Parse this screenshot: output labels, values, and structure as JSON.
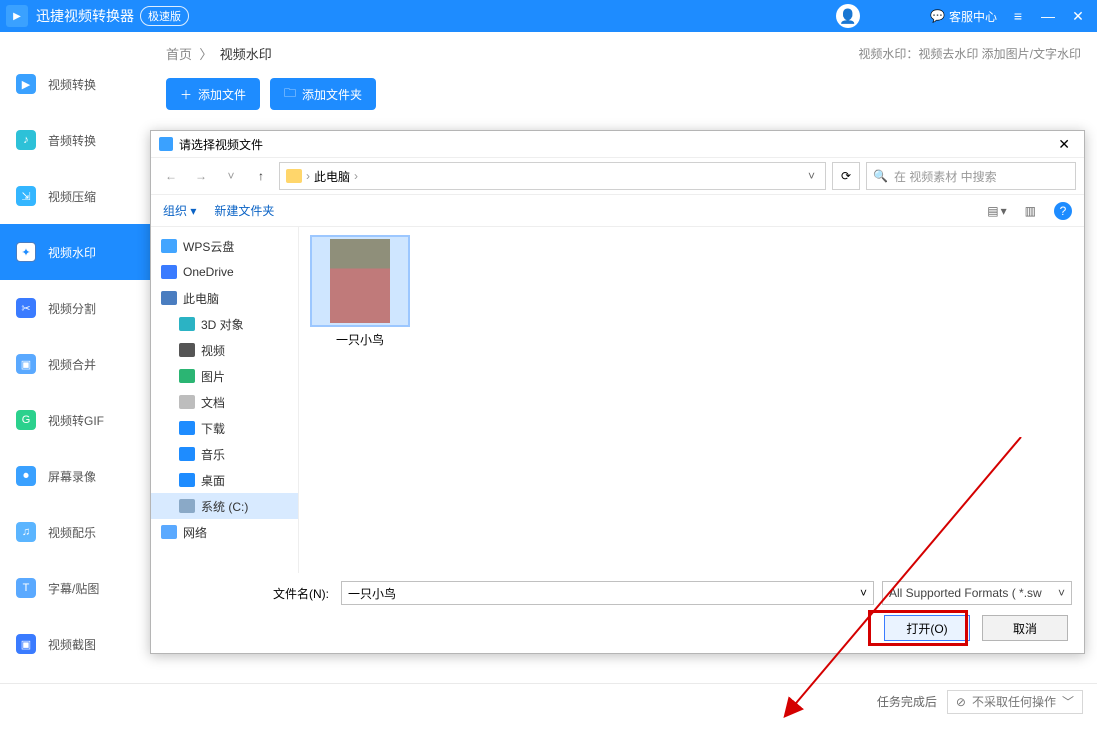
{
  "titlebar": {
    "app_name": "迅捷视频转换器",
    "version_badge": "极速版",
    "help_center": "客服中心"
  },
  "sidebar": {
    "items": [
      {
        "label": "视频转换"
      },
      {
        "label": "音频转换"
      },
      {
        "label": "视频压缩"
      },
      {
        "label": "视频水印"
      },
      {
        "label": "视频分割"
      },
      {
        "label": "视频合并"
      },
      {
        "label": "视频转GIF"
      },
      {
        "label": "屏幕录像"
      },
      {
        "label": "视频配乐"
      },
      {
        "label": "字幕/贴图"
      },
      {
        "label": "视频截图"
      }
    ]
  },
  "crumbs": {
    "home": "首页",
    "sep": "〉",
    "current": "视频水印",
    "hint": "视频水印：视频去水印 添加图片/文字水印"
  },
  "actions": {
    "add_file": "添加文件",
    "add_folder": "添加文件夹"
  },
  "footer": {
    "done_label": "任务完成后",
    "action": "不采取任何操作"
  },
  "dialog": {
    "title": "请选择视频文件",
    "path": {
      "root": "此电脑"
    },
    "search_placeholder": "在 视频素材 中搜索",
    "toolbar": {
      "organize": "组织",
      "newfolder": "新建文件夹"
    },
    "tree": [
      {
        "label": "WPS云盘",
        "cls": "ic-cloud"
      },
      {
        "label": "OneDrive",
        "cls": "ic-blue"
      },
      {
        "label": "此电脑",
        "cls": "ic-mon"
      },
      {
        "label": "3D 对象",
        "cls": "ic-cube",
        "child": true
      },
      {
        "label": "视频",
        "cls": "ic-film",
        "child": true
      },
      {
        "label": "图片",
        "cls": "ic-img",
        "child": true
      },
      {
        "label": "文档",
        "cls": "ic-doc",
        "child": true
      },
      {
        "label": "下载",
        "cls": "ic-dl",
        "child": true
      },
      {
        "label": "音乐",
        "cls": "ic-music",
        "child": true
      },
      {
        "label": "桌面",
        "cls": "ic-desk",
        "child": true
      },
      {
        "label": "系统 (C:)",
        "cls": "ic-disk",
        "child": true,
        "selected": true
      },
      {
        "label": "网络",
        "cls": "ic-net"
      }
    ],
    "file": {
      "name": "一只小鸟"
    },
    "fn_label": "文件名(N):",
    "fn_value": "一只小鸟",
    "filter": "All Supported Formats ( *.sw",
    "btn_open": "打开(O)",
    "btn_cancel": "取消"
  }
}
